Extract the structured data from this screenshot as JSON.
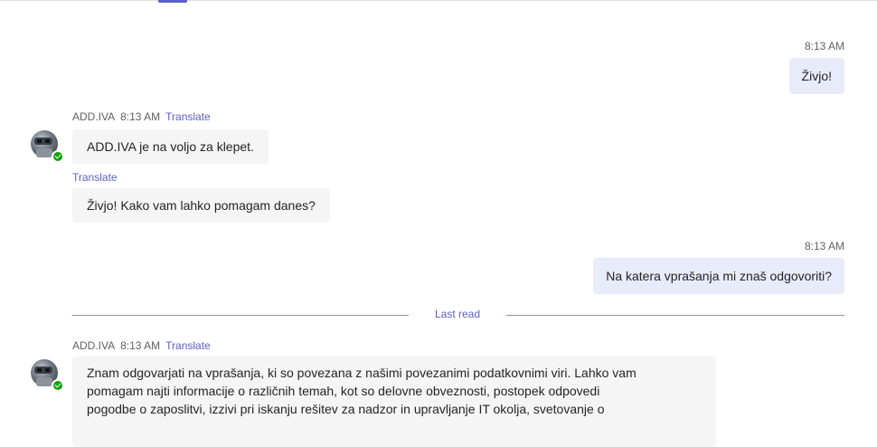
{
  "colors": {
    "accent": "#5b5fc7",
    "my_bubble": "#e8ebfa",
    "bot_bubble": "#f5f5f5",
    "presence": "#13a10e"
  },
  "messages": [
    {
      "from": "me",
      "time": "8:13 AM",
      "text": "Živjo!"
    },
    {
      "from": "bot",
      "sender": "ADD.IVA",
      "time": "8:13 AM",
      "translate": "Translate",
      "text": "ADD.IVA je na voljo za klepet."
    },
    {
      "from": "bot",
      "translate": "Translate",
      "text": "Živjo! Kako vam lahko pomagam danes?"
    },
    {
      "from": "me",
      "time": "8:13 AM",
      "text": "Na katera vprašanja mi znaš odgovoriti?"
    },
    {
      "from": "bot",
      "sender": "ADD.IVA",
      "time": "8:13 AM",
      "translate": "Translate",
      "lines": [
        "Znam odgovarjati na vprašanja, ki so povezana z našimi povezanimi podatkovnimi viri. Lahko vam",
        "pomagam najti informacije o različnih temah, kot so delovne obveznosti, postopek odpovedi",
        "pogodbe o zaposlitvi, izzivi pri iskanju rešitev za nadzor in upravljanje IT okolja, svetovanje o"
      ]
    }
  ],
  "divider": {
    "label": "Last read"
  },
  "avatar": {
    "icon": "robot-avatar-icon",
    "presence": "available"
  }
}
